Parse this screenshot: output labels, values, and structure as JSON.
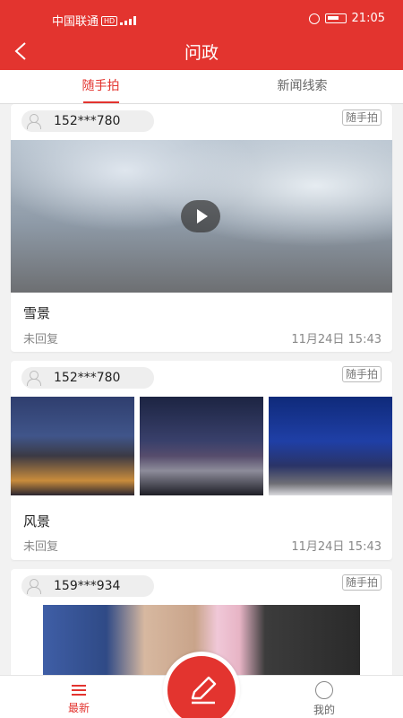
{
  "status_bar": {
    "carrier": "中国联通",
    "hd": "HD",
    "network": "4G",
    "battery": "96",
    "time": "21:05"
  },
  "header": {
    "title": "问政"
  },
  "tabs": [
    {
      "label": "随手拍",
      "active": true
    },
    {
      "label": "新闻线索",
      "active": false
    }
  ],
  "posts": [
    {
      "user": "152***780",
      "tag": "随手拍",
      "media": "video",
      "title": "雪景",
      "status": "未回复",
      "time": "11月24日 15:43"
    },
    {
      "user": "152***780",
      "tag": "随手拍",
      "media": "images",
      "title": "风景",
      "status": "未回复",
      "time": "11月24日 15:43"
    },
    {
      "user": "159***934",
      "tag": "随手拍",
      "media": "image"
    }
  ],
  "bottom_nav": {
    "latest_label": "最新",
    "me_label": "我的"
  },
  "colors": {
    "brand_red": "#e3342f"
  }
}
